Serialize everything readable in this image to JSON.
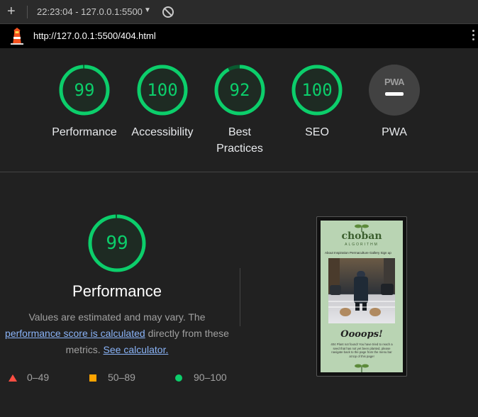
{
  "toolbar": {
    "new_report": "+",
    "report_label": "22:23:04 - 127.0.0.1:5500",
    "dropdown": "▼"
  },
  "url": "http://127.0.0.1:5500/404.html",
  "scores": [
    {
      "label": "Performance",
      "value": "99",
      "pct": 0.99
    },
    {
      "label": "Accessibility",
      "value": "100",
      "pct": 1.0
    },
    {
      "label": "Best Practices",
      "value": "92",
      "pct": 0.92
    },
    {
      "label": "SEO",
      "value": "100",
      "pct": 1.0
    }
  ],
  "pwa": {
    "badge": "PWA",
    "label": "PWA"
  },
  "performance": {
    "score": "99",
    "pct": 0.99,
    "title": "Performance",
    "desc_1": "Values are estimated and may vary. The ",
    "link_1": "performance score is calculated",
    "desc_2": " directly from these metrics. ",
    "link_2": "See calculator."
  },
  "legend": {
    "fail": "0–49",
    "average": "50–89",
    "pass": "90–100"
  },
  "thumbnail": {
    "brand": "choban",
    "subtitle": "ALGORITHM",
    "nav": "About  Inspiration  Permaculture  Gallery  Sign up",
    "heading": "Oooops!",
    "message": "404 Plant not found! You have tried to reach a seed that has not yet been planted, please navigate back to the page from the menu bar at top of this page!"
  },
  "colors": {
    "pass": "#0cce6b",
    "average": "#ffa400",
    "fail": "#ff4e42",
    "link": "#8ab4f8"
  }
}
